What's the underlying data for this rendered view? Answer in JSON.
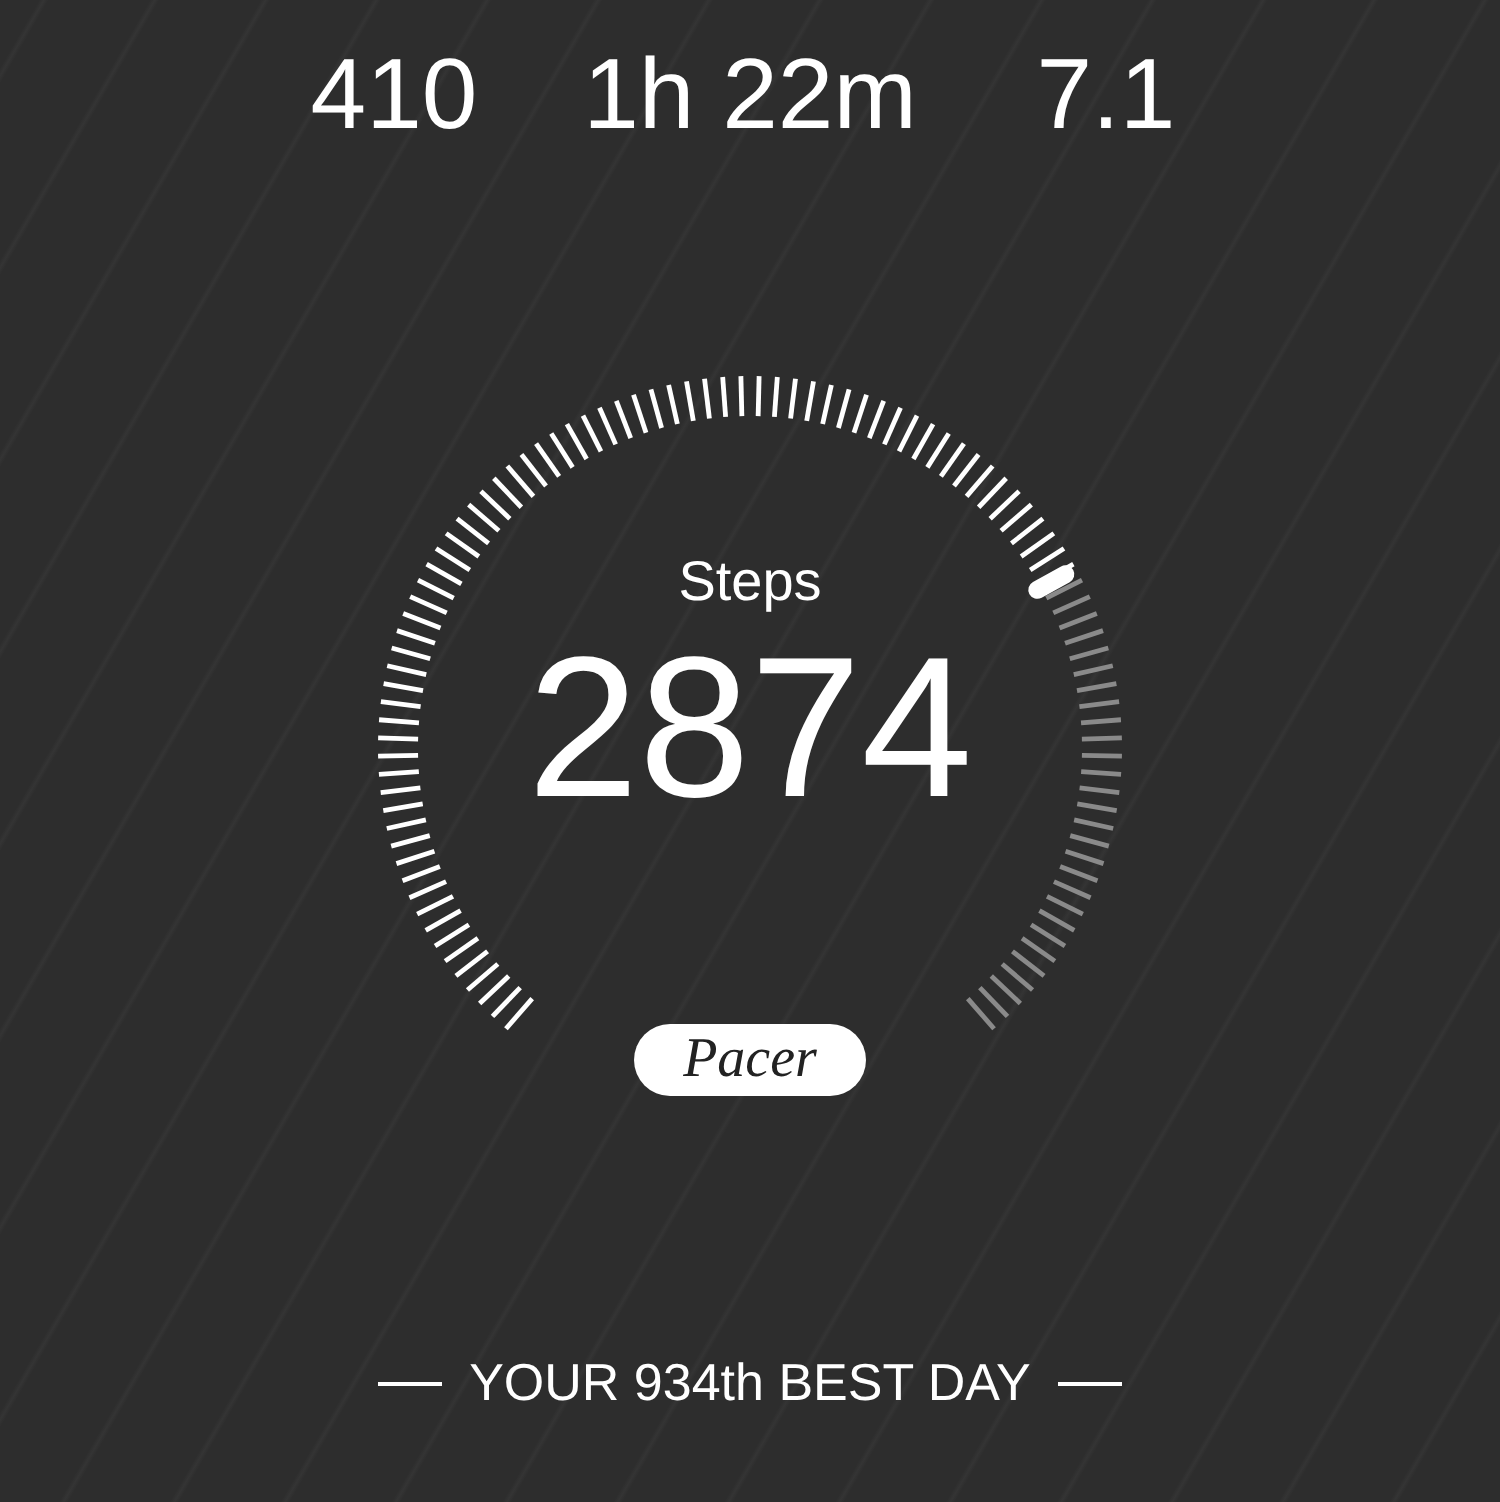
{
  "stats": [
    {
      "value": "410"
    },
    {
      "value": "1h 22m"
    },
    {
      "value": "7.1"
    }
  ],
  "gauge": {
    "label": "Steps",
    "value": "2874"
  },
  "logo": "Pacer",
  "rank_text": "YOUR 934th BEST DAY"
}
